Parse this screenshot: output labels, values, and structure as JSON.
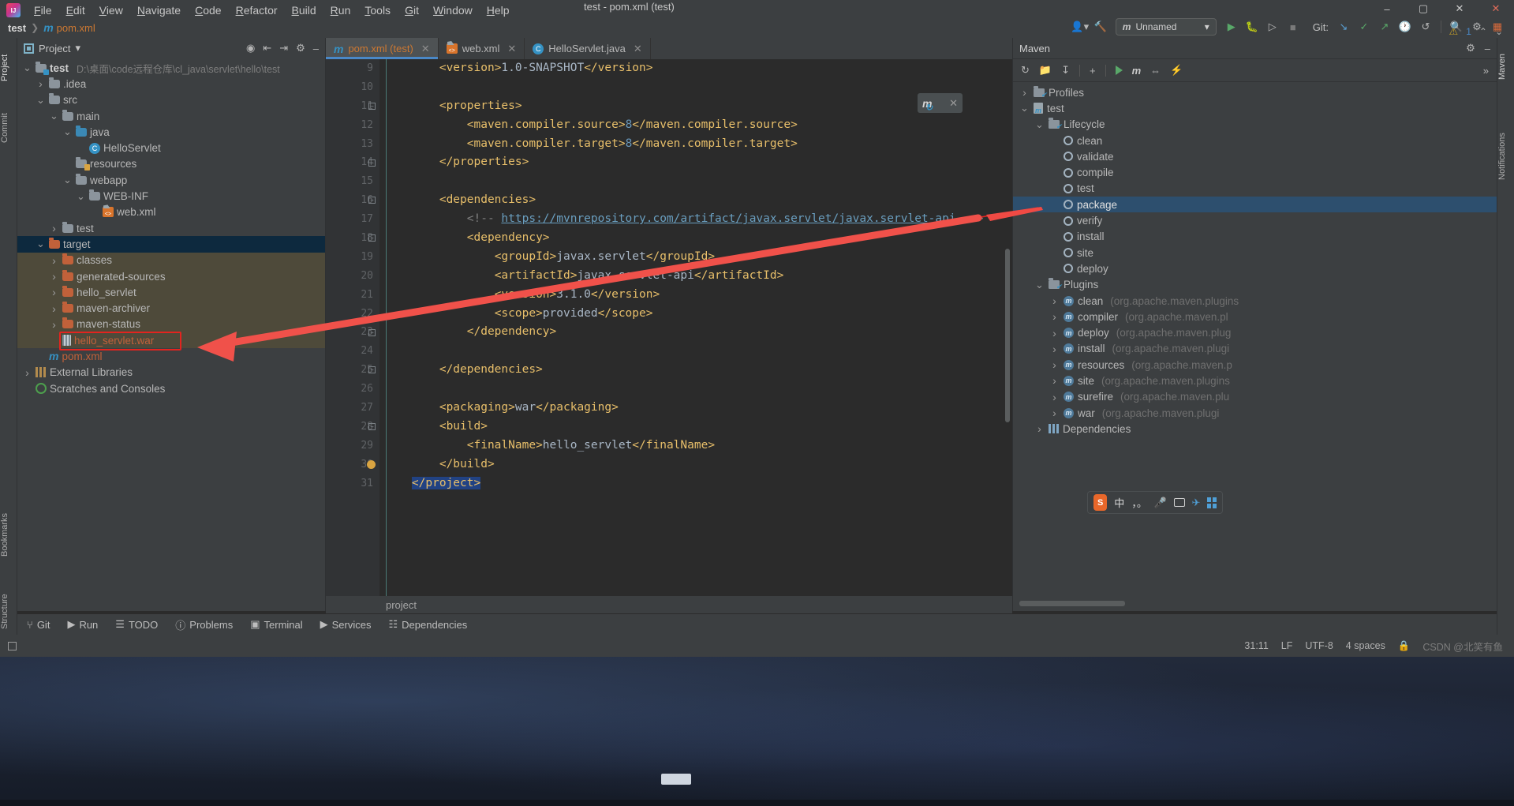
{
  "window": {
    "title": "test - pom.xml (test)",
    "minimize": "–",
    "maximize": "▢",
    "close": "✕",
    "close2": "✕"
  },
  "menu": {
    "logo": "intellij-logo",
    "items": [
      "File",
      "Edit",
      "View",
      "Navigate",
      "Code",
      "Refactor",
      "Build",
      "Run",
      "Tools",
      "Git",
      "Window",
      "Help"
    ]
  },
  "breadcrumb": {
    "project": "test",
    "separator": "❯",
    "file_icon": "m",
    "file": "pom.xml"
  },
  "toolbar": {
    "user_icon": "user-icon",
    "hammer_icon": "build-icon",
    "run_config": "Unnamed",
    "run_config_icon": "maven-icon",
    "run_icon": "▶",
    "debug_icon": "debug-icon",
    "coverage_icon": "coverage-icon",
    "stop_icon": "■",
    "git_label": "Git:",
    "git_update": "↙",
    "git_commit": "✓",
    "git_push": "↗",
    "git_history": "🕑",
    "git_rollback": "↺",
    "search_icon": "🔍",
    "settings_icon": "⚙",
    "layout_icon": "▣"
  },
  "left_strip": {
    "tabs": [
      {
        "label": "Project",
        "icon": "project-icon",
        "selected": true
      },
      {
        "label": "Commit",
        "icon": "commit-icon",
        "selected": false
      },
      {
        "label": "Bookmarks",
        "icon": "bookmarks-icon",
        "selected": false
      },
      {
        "label": "Structure",
        "icon": "structure-icon",
        "selected": false
      }
    ]
  },
  "right_strip": {
    "tabs": [
      {
        "label": "Maven",
        "icon": "maven-icon"
      },
      {
        "label": "Notifications",
        "icon": "bell-icon"
      }
    ]
  },
  "project_panel": {
    "title": "Project",
    "dropdown": "▾",
    "actions": [
      "locate-icon",
      "expand-all-icon",
      "collapse-all-icon",
      "settings-icon",
      "hide-icon"
    ],
    "tree": [
      {
        "indent": 0,
        "arrow": "v",
        "icon": "module-folder",
        "label": "test",
        "bold": true,
        "path": "D:\\桌面\\code远程仓库\\cl_java\\servlet\\hello\\test",
        "state": "normal"
      },
      {
        "indent": 1,
        "arrow": ">",
        "icon": "folder-gray",
        "label": ".idea",
        "state": "normal"
      },
      {
        "indent": 1,
        "arrow": "v",
        "icon": "folder-gray",
        "label": "src",
        "state": "normal"
      },
      {
        "indent": 2,
        "arrow": "v",
        "icon": "folder-gray",
        "label": "main",
        "state": "normal"
      },
      {
        "indent": 3,
        "arrow": "v",
        "icon": "folder-blue",
        "label": "java",
        "state": "normal"
      },
      {
        "indent": 4,
        "arrow": "",
        "icon": "class-icon",
        "label": "HelloServlet",
        "state": "normal"
      },
      {
        "indent": 3,
        "arrow": "",
        "icon": "folder-resources",
        "label": "resources",
        "state": "normal"
      },
      {
        "indent": 3,
        "arrow": "v",
        "icon": "folder-gray",
        "label": "webapp",
        "state": "normal"
      },
      {
        "indent": 4,
        "arrow": "v",
        "icon": "folder-gray",
        "label": "WEB-INF",
        "state": "normal"
      },
      {
        "indent": 5,
        "arrow": "",
        "icon": "xml-icon",
        "label": "web.xml",
        "state": "normal"
      },
      {
        "indent": 2,
        "arrow": ">",
        "icon": "folder-gray",
        "label": "test",
        "state": "normal"
      },
      {
        "indent": 1,
        "arrow": "v",
        "icon": "folder-orange",
        "label": "target",
        "state": "selected"
      },
      {
        "indent": 2,
        "arrow": ">",
        "icon": "folder-orange",
        "label": "classes",
        "state": "inTarget"
      },
      {
        "indent": 2,
        "arrow": ">",
        "icon": "folder-orange",
        "label": "generated-sources",
        "state": "inTarget"
      },
      {
        "indent": 2,
        "arrow": ">",
        "icon": "folder-orange",
        "label": "hello_servlet",
        "state": "inTarget"
      },
      {
        "indent": 2,
        "arrow": ">",
        "icon": "folder-orange",
        "label": "maven-archiver",
        "state": "inTarget"
      },
      {
        "indent": 2,
        "arrow": ">",
        "icon": "folder-orange",
        "label": "maven-status",
        "state": "inTarget"
      },
      {
        "indent": 2,
        "arrow": "",
        "icon": "war-icon",
        "label": "hello_servlet.war",
        "state": "inTarget",
        "name_class": "war"
      },
      {
        "indent": 1,
        "arrow": "",
        "icon": "maven-pom-icon",
        "label": "pom.xml",
        "state": "normal",
        "name_class": "pom"
      },
      {
        "indent": 0,
        "arrow": ">",
        "icon": "library-icon",
        "label": "External Libraries",
        "state": "normal"
      },
      {
        "indent": 0,
        "arrow": "",
        "icon": "scratches-icon",
        "label": "Scratches and Consoles",
        "state": "normal"
      }
    ]
  },
  "editor": {
    "tabs": [
      {
        "icon": "maven-icon",
        "label": "pom.xml (test)",
        "active": true,
        "close": "✕"
      },
      {
        "icon": "xml-icon",
        "label": "web.xml",
        "active": false,
        "close": "✕"
      },
      {
        "icon": "class-icon",
        "label": "HelloServlet.java",
        "active": false,
        "close": "✕"
      }
    ],
    "inspection": {
      "warning_icon": "⚠",
      "warning_count": "1",
      "prev": "⌃",
      "next": "⌄"
    },
    "breadcrumb": "project",
    "reimport_popup": {
      "icon": "maven-reimport-icon",
      "close": "✕"
    },
    "first_line_number": 9,
    "lines": [
      {
        "n": 9,
        "indent": 2,
        "fold": "",
        "parts": [
          {
            "t": "tag",
            "s": "<version>"
          },
          {
            "t": "val",
            "s": "1.0-SNAPSHOT"
          },
          {
            "t": "tag",
            "s": "</version>"
          }
        ]
      },
      {
        "n": 10,
        "indent": 0,
        "fold": "",
        "parts": []
      },
      {
        "n": 11,
        "indent": 2,
        "fold": "minus-top",
        "parts": [
          {
            "t": "tag",
            "s": "<properties>"
          }
        ]
      },
      {
        "n": 12,
        "indent": 3,
        "fold": "",
        "parts": [
          {
            "t": "tag",
            "s": "<maven.compiler.source>"
          },
          {
            "t": "num",
            "s": "8"
          },
          {
            "t": "tag",
            "s": "</maven.compiler.source>"
          }
        ]
      },
      {
        "n": 13,
        "indent": 3,
        "fold": "",
        "parts": [
          {
            "t": "tag",
            "s": "<maven.compiler.target>"
          },
          {
            "t": "num",
            "s": "8"
          },
          {
            "t": "tag",
            "s": "</maven.compiler.target>"
          }
        ]
      },
      {
        "n": 14,
        "indent": 2,
        "fold": "minus-bottom",
        "parts": [
          {
            "t": "tag",
            "s": "</properties>"
          }
        ]
      },
      {
        "n": 15,
        "indent": 0,
        "fold": "",
        "parts": []
      },
      {
        "n": 16,
        "indent": 2,
        "fold": "minus-top",
        "parts": [
          {
            "t": "tag",
            "s": "<dependencies>"
          }
        ]
      },
      {
        "n": 17,
        "indent": 3,
        "fold": "",
        "parts": [
          {
            "t": "com",
            "s": "<!-- "
          },
          {
            "t": "url",
            "s": "https://mvnrepository.com/artifact/javax.servlet/javax.servlet-api"
          },
          {
            "t": "com",
            "s": " -->"
          }
        ]
      },
      {
        "n": 18,
        "indent": 3,
        "fold": "minus-top",
        "parts": [
          {
            "t": "tag",
            "s": "<dependency>"
          }
        ]
      },
      {
        "n": 19,
        "indent": 4,
        "fold": "",
        "parts": [
          {
            "t": "tag",
            "s": "<groupId>"
          },
          {
            "t": "val",
            "s": "javax.servlet"
          },
          {
            "t": "tag",
            "s": "</groupId>"
          }
        ]
      },
      {
        "n": 20,
        "indent": 4,
        "fold": "",
        "parts": [
          {
            "t": "tag",
            "s": "<artifactId>"
          },
          {
            "t": "val",
            "s": "javax.servlet-api"
          },
          {
            "t": "tag",
            "s": "</artifactId>"
          }
        ]
      },
      {
        "n": 21,
        "indent": 4,
        "fold": "",
        "parts": [
          {
            "t": "tag",
            "s": "<version>"
          },
          {
            "t": "val",
            "s": "3.1.0"
          },
          {
            "t": "tag",
            "s": "</version>"
          }
        ]
      },
      {
        "n": 22,
        "indent": 4,
        "fold": "",
        "parts": [
          {
            "t": "tag",
            "s": "<scope>"
          },
          {
            "t": "val",
            "s": "provided"
          },
          {
            "t": "tag",
            "s": "</scope>"
          }
        ]
      },
      {
        "n": 23,
        "indent": 3,
        "fold": "minus-bottom",
        "parts": [
          {
            "t": "tag",
            "s": "</dependency>"
          }
        ]
      },
      {
        "n": 24,
        "indent": 0,
        "fold": "",
        "parts": []
      },
      {
        "n": 25,
        "indent": 2,
        "fold": "minus-bottom",
        "parts": [
          {
            "t": "tag",
            "s": "</dependencies>"
          }
        ]
      },
      {
        "n": 26,
        "indent": 0,
        "fold": "",
        "parts": []
      },
      {
        "n": 27,
        "indent": 2,
        "fold": "",
        "parts": [
          {
            "t": "tag",
            "s": "<packaging>"
          },
          {
            "t": "val",
            "s": "war"
          },
          {
            "t": "tag",
            "s": "</packaging>"
          }
        ]
      },
      {
        "n": 28,
        "indent": 2,
        "fold": "minus-top",
        "parts": [
          {
            "t": "tag",
            "s": "<build>"
          }
        ]
      },
      {
        "n": 29,
        "indent": 3,
        "fold": "",
        "parts": [
          {
            "t": "tag",
            "s": "<finalName>"
          },
          {
            "t": "val",
            "s": "hello_servlet"
          },
          {
            "t": "tag",
            "s": "</finalName>"
          }
        ]
      },
      {
        "n": 30,
        "indent": 2,
        "fold": "bulb",
        "parts": [
          {
            "t": "tag",
            "s": "</build>"
          }
        ]
      },
      {
        "n": 31,
        "indent": 1,
        "fold": "",
        "parts": [
          {
            "t": "sel",
            "s": "</project>"
          }
        ]
      }
    ]
  },
  "maven_panel": {
    "title": "Maven",
    "settings_icon": "⚙",
    "hide_icon": "–",
    "toolbar": [
      "reload-icon",
      "add-module-icon",
      "download-sources-icon",
      "plus-icon",
      "run-icon",
      "execute-goal-icon",
      "toggle-offline-icon",
      "show-diagram-icon",
      "more-icon"
    ],
    "tree": [
      {
        "indent": 0,
        "arrow": ">",
        "icon": "profiles-icon",
        "label": "Profiles"
      },
      {
        "indent": 0,
        "arrow": "v",
        "icon": "maven-pom-icon",
        "label": "test"
      },
      {
        "indent": 1,
        "arrow": "v",
        "icon": "lifecycle-icon",
        "label": "Lifecycle"
      },
      {
        "indent": 2,
        "arrow": "",
        "icon": "gear-icon",
        "label": "clean"
      },
      {
        "indent": 2,
        "arrow": "",
        "icon": "gear-icon",
        "label": "validate"
      },
      {
        "indent": 2,
        "arrow": "",
        "icon": "gear-icon",
        "label": "compile"
      },
      {
        "indent": 2,
        "arrow": "",
        "icon": "gear-icon",
        "label": "test"
      },
      {
        "indent": 2,
        "arrow": "",
        "icon": "gear-icon",
        "label": "package",
        "selected": true
      },
      {
        "indent": 2,
        "arrow": "",
        "icon": "gear-icon",
        "label": "verify"
      },
      {
        "indent": 2,
        "arrow": "",
        "icon": "gear-icon",
        "label": "install"
      },
      {
        "indent": 2,
        "arrow": "",
        "icon": "gear-icon",
        "label": "site"
      },
      {
        "indent": 2,
        "arrow": "",
        "icon": "gear-icon",
        "label": "deploy"
      },
      {
        "indent": 1,
        "arrow": "v",
        "icon": "plugins-icon",
        "label": "Plugins"
      },
      {
        "indent": 2,
        "arrow": ">",
        "icon": "plugin-icon",
        "label": "clean",
        "sub": "(org.apache.maven.plugins"
      },
      {
        "indent": 2,
        "arrow": ">",
        "icon": "plugin-icon",
        "label": "compiler",
        "sub": "(org.apache.maven.pl"
      },
      {
        "indent": 2,
        "arrow": ">",
        "icon": "plugin-icon",
        "label": "deploy",
        "sub": "(org.apache.maven.plug"
      },
      {
        "indent": 2,
        "arrow": ">",
        "icon": "plugin-icon",
        "label": "install",
        "sub": "(org.apache.maven.plugi"
      },
      {
        "indent": 2,
        "arrow": ">",
        "icon": "plugin-icon",
        "label": "resources",
        "sub": "(org.apache.maven.p"
      },
      {
        "indent": 2,
        "arrow": ">",
        "icon": "plugin-icon",
        "label": "site",
        "sub": "(org.apache.maven.plugins"
      },
      {
        "indent": 2,
        "arrow": ">",
        "icon": "plugin-icon",
        "label": "surefire",
        "sub": "(org.apache.maven.plu"
      },
      {
        "indent": 2,
        "arrow": ">",
        "icon": "plugin-icon",
        "label": "war",
        "sub": "(org.apache.maven.plugi"
      },
      {
        "indent": 1,
        "arrow": ">",
        "icon": "dependencies-icon",
        "label": "Dependencies"
      }
    ]
  },
  "bottom_bar": {
    "items": [
      {
        "icon": "git-icon",
        "label": "Git"
      },
      {
        "icon": "run-icon",
        "label": "Run"
      },
      {
        "icon": "todo-icon",
        "label": "TODO"
      },
      {
        "icon": "problems-icon",
        "label": "Problems"
      },
      {
        "icon": "terminal-icon",
        "label": "Terminal"
      },
      {
        "icon": "services-icon",
        "label": "Services"
      },
      {
        "icon": "dependencies-icon",
        "label": "Dependencies"
      }
    ]
  },
  "status_bar": {
    "left_icon": "memory-icon",
    "caret": "31:11",
    "line_separator": "LF",
    "encoding": "UTF-8",
    "indent": "4 spaces",
    "watermark": "CSDN @北笑有鱼",
    "lock_icon": "🔒"
  },
  "ime": {
    "logo": "S",
    "mode": "中",
    "punct": "，。",
    "mic_icon": "🎤",
    "keyboard_icon": "keyboard-icon",
    "toolbox_icon": "toolbox-icon",
    "panel_icon": "panel-icon"
  },
  "colors": {
    "accent_blue": "#3592c4",
    "selection_blue": "#0d293e",
    "maven_selection": "#2d4f6e",
    "annotation_red": "#e2241f",
    "folder_orange": "#c1613a",
    "tag_yellow": "#e8bf6a",
    "target_bg": "#4e4a3a"
  }
}
